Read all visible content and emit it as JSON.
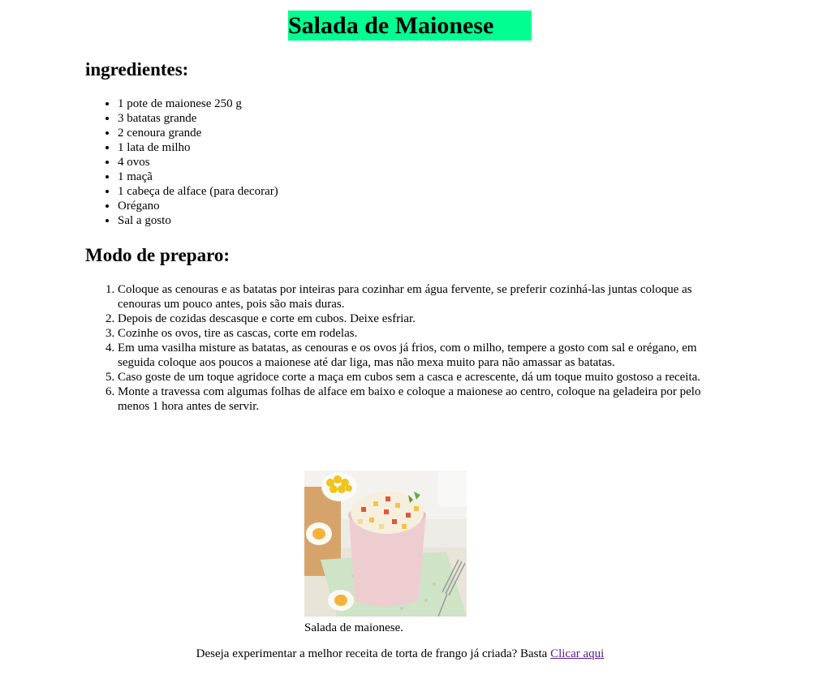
{
  "title": "Salada de Maionese",
  "ingredients": {
    "heading": "ingredientes:",
    "items": [
      "1 pote de maionese 250 g",
      "3 batatas grande",
      "2 cenoura grande",
      "1 lata de milho",
      "4 ovos",
      "1 maçã",
      "1 cabeça de alface (para decorar)",
      "Orégano",
      "Sal a gosto"
    ]
  },
  "preparation": {
    "heading": "Modo de preparo:",
    "steps": [
      "Coloque as cenouras e as batatas por inteiras para cozinhar em água fervente, se preferir cozinhá-las juntas coloque as cenouras um pouco antes, pois são mais duras.",
      "Depois de cozidas descasque e corte em cubos. Deixe esfriar.",
      "Cozinhe os ovos, tire as cascas, corte em rodelas.",
      "Em uma vasilha misture as batatas, as cenouras e os ovos já frios, com o milho, tempere a gosto com sal e orégano, em seguida coloque aos poucos a maionese até dar liga, mas não mexa muito para não amassar as batatas.",
      "Caso goste de um toque agridoce corte a maça em cubos sem a casca e acrescente, dá um toque muito gostoso a receita.",
      "Monte a travessa com algumas folhas de alface em baixo e coloque a maionese ao centro, coloque na geladeira por pelo menos 1 hora antes de servir."
    ]
  },
  "figure": {
    "caption": "Salada de maionese."
  },
  "footer": {
    "text": "Deseja experimentar a melhor receita de torta de frango já criada? Basta ",
    "link_label": "Clicar aqui"
  },
  "colors": {
    "title_background": "#00ff90",
    "link": "#551a8b"
  }
}
